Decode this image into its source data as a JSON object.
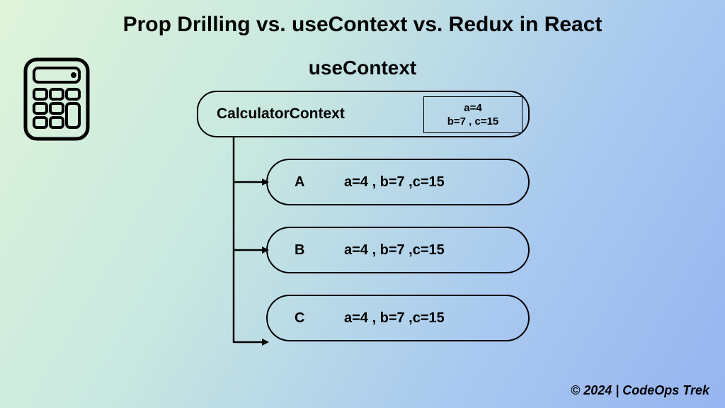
{
  "title": "Prop Drilling vs. useContext vs. Redux in React",
  "subtitle": "useContext",
  "context": {
    "label": "CalculatorContext",
    "data_line1": "a=4",
    "data_line2": "b=7 , c=15"
  },
  "nodes": [
    {
      "letter": "A",
      "values": "a=4 , b=7 ,c=15"
    },
    {
      "letter": "B",
      "values": "a=4 , b=7 ,c=15"
    },
    {
      "letter": "C",
      "values": "a=4 , b=7 ,c=15"
    }
  ],
  "footer": "© 2024 | CodeOps Trek"
}
